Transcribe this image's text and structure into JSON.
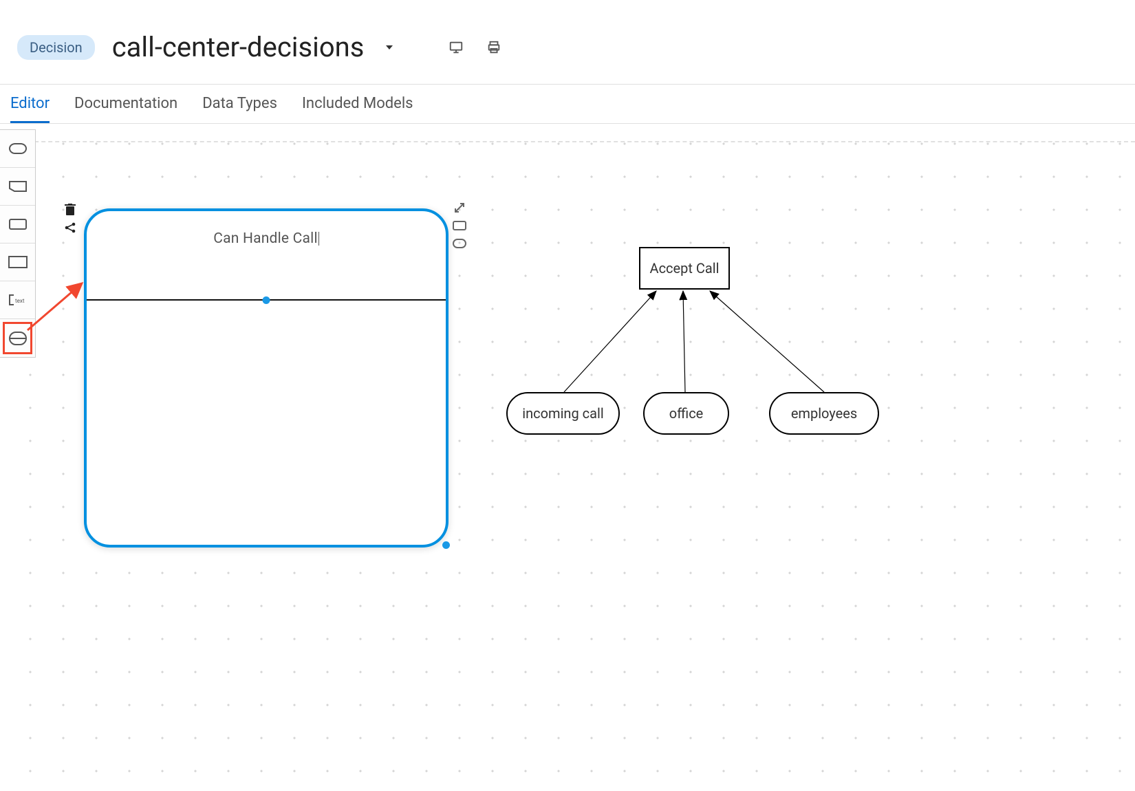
{
  "header": {
    "badge": "Decision",
    "title": "call-center-decisions"
  },
  "tabs": {
    "editor": "Editor",
    "documentation": "Documentation",
    "data_types": "Data Types",
    "included_models": "Included Models"
  },
  "canvas": {
    "decision_service_title": "Can Handle Call",
    "accept_label": "Accept Call",
    "inputs": {
      "incoming": "incoming call",
      "office": "office",
      "employees": "employees"
    }
  }
}
